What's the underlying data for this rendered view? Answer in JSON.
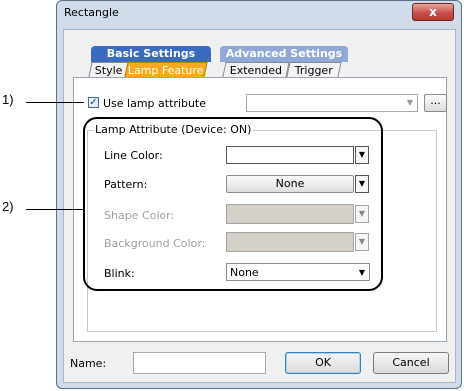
{
  "window": {
    "title": "Rectangle",
    "close_glyph": "x"
  },
  "tab_groups": [
    {
      "label": "Basic Settings",
      "active": true,
      "subtabs": [
        "Style",
        "Lamp Feature"
      ],
      "active_subtab": "Lamp Feature"
    },
    {
      "label": "Advanced Settings",
      "active": false,
      "subtabs": [
        "Extended",
        "Trigger"
      ]
    }
  ],
  "lamp": {
    "use_label": "Use lamp attribute",
    "checked": true,
    "device_value": "",
    "ellipsis_label": "..."
  },
  "lamp_attribute": {
    "group_title": "Lamp Attribute (Device: ON)",
    "line_color_label": "Line Color:",
    "pattern_label": "Pattern:",
    "pattern_value": "None",
    "shape_color_label": "Shape Color:",
    "background_color_label": "Background Color:",
    "blink_label": "Blink:",
    "blink_value": "None"
  },
  "callouts": {
    "one": "1)",
    "two": "2)"
  },
  "footer": {
    "name_label": "Name:",
    "name_value": "",
    "ok_label": "OK",
    "cancel_label": "Cancel"
  },
  "colors": {
    "accent_tab": "#3a6bc0",
    "active_subtab": "#f7a91f",
    "close_button": "#c75050"
  },
  "icons": {
    "close": "close-icon",
    "check": "checkmark-icon",
    "dropdown": "chevron-down-icon"
  }
}
